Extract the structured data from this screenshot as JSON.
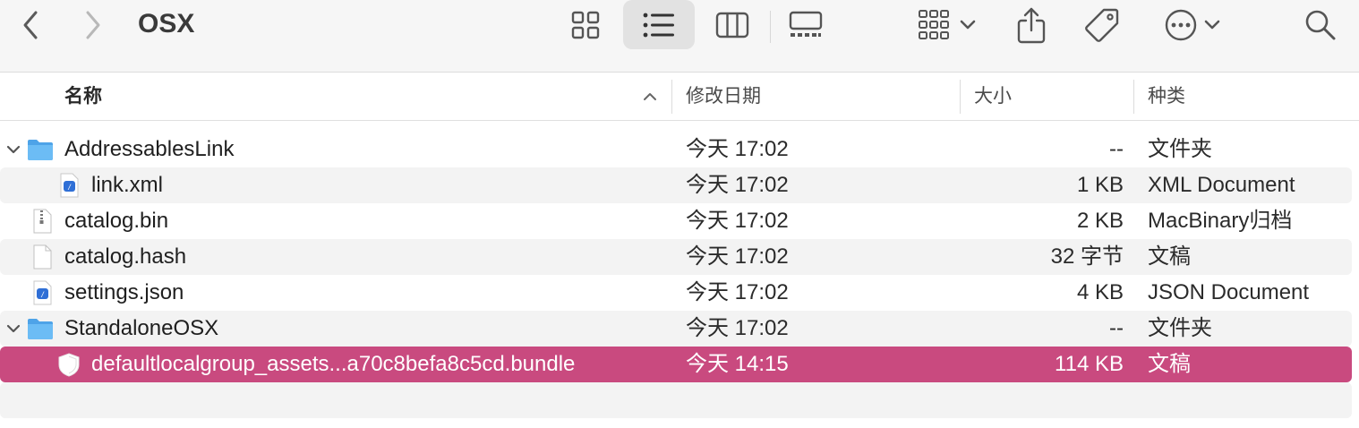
{
  "window": {
    "title": "OSX"
  },
  "toolbar": {
    "back_icon": "chevron-left-icon",
    "forward_icon": "chevron-right-icon",
    "view_icon_grid": "grid-view-icon",
    "view_icon_list": "list-view-icon",
    "view_icon_columns": "column-view-icon",
    "view_icon_gallery": "gallery-view-icon",
    "group_icon": "group-by-icon",
    "share_icon": "share-icon",
    "tag_icon": "tag-icon",
    "more_icon": "ellipsis-circle-icon",
    "search_icon": "search-icon"
  },
  "columns": {
    "name": "名称",
    "date": "修改日期",
    "size": "大小",
    "kind": "种类"
  },
  "rows": [
    {
      "name": "AddressablesLink",
      "date": "今天 17:02",
      "size": "--",
      "kind": "文件夹",
      "icon": "folder-icon",
      "disclosure": "expanded"
    },
    {
      "name": "link.xml",
      "date": "今天 17:02",
      "size": "1 KB",
      "kind": "XML Document",
      "icon": "xml-document-icon"
    },
    {
      "name": "catalog.bin",
      "date": "今天 17:02",
      "size": "2 KB",
      "kind": "MacBinary归档",
      "icon": "archive-file-icon"
    },
    {
      "name": "catalog.hash",
      "date": "今天 17:02",
      "size": "32 字节",
      "kind": "文稿",
      "icon": "blank-document-icon"
    },
    {
      "name": "settings.json",
      "date": "今天 17:02",
      "size": "4 KB",
      "kind": "JSON Document",
      "icon": "json-document-icon"
    },
    {
      "name": "StandaloneOSX",
      "date": "今天 17:02",
      "size": "--",
      "kind": "文件夹",
      "icon": "folder-icon",
      "disclosure": "expanded"
    },
    {
      "name": "defaultlocalgroup_assets...a70c8befa8c5cd.bundle",
      "date": "今天 14:15",
      "size": "114 KB",
      "kind": "文稿",
      "icon": "bundle-document-icon",
      "selected": true
    }
  ],
  "colors": {
    "selection": "#c94a7f",
    "folder": "#5aaef0",
    "toolbar_bg": "#f6f6f6"
  }
}
